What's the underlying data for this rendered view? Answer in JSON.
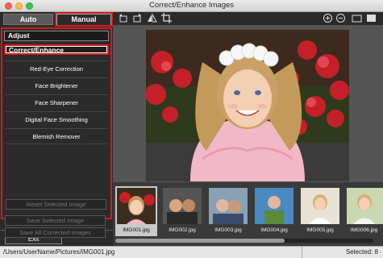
{
  "window": {
    "title": "Correct/Enhance Images"
  },
  "tabs": {
    "auto": "Auto",
    "manual": "Manual"
  },
  "sections": {
    "adjust": "Adjust",
    "correct": "Correct/Enhance"
  },
  "features": [
    "Red-Eye Correction",
    "Face Brightener",
    "Face Sharpener",
    "Digital Face Smoothing",
    "Blemish Remover"
  ],
  "buttons": {
    "reset": "Reset Selected Image",
    "save_selected": "Save Selected Image",
    "save_all": "Save All Corrected Images",
    "exit": "Exit"
  },
  "toolbar": {
    "icons": [
      "rotate-left-icon",
      "rotate-right-icon",
      "flip-icon",
      "crop-icon",
      "zoom-in-icon",
      "zoom-out-icon",
      "fullscreen-icon",
      "fit-screen-icon"
    ]
  },
  "thumbnails": [
    {
      "name": "IMG001.jpg",
      "selected": true
    },
    {
      "name": "IMG002.jpg",
      "selected": false
    },
    {
      "name": "IMG003.jpg",
      "selected": false
    },
    {
      "name": "IMG004.jpg",
      "selected": false
    },
    {
      "name": "IMG005.jpg",
      "selected": false
    },
    {
      "name": "IMG006.jpg",
      "selected": false
    }
  ],
  "status": {
    "path": "/Users/UserName/Pictures/IMG001.jpg",
    "selected": "Selected: 8"
  },
  "colors": {
    "highlight": "#d21b1b",
    "panel": "#2b2b2b"
  }
}
